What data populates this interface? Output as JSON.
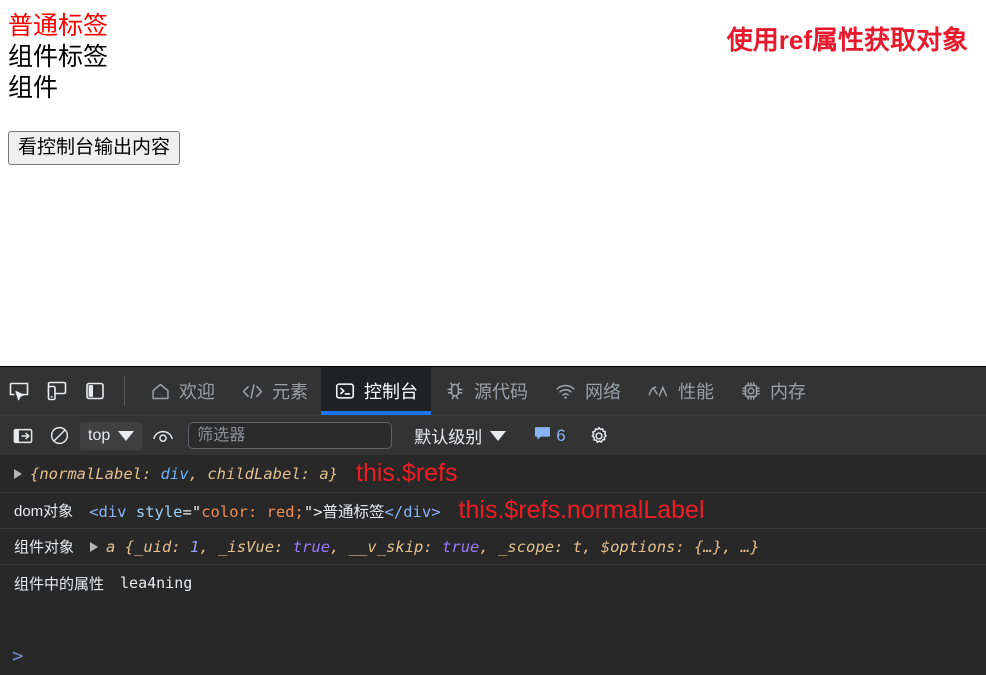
{
  "page": {
    "lines": [
      {
        "text": "普通标签",
        "color": "#ff0000"
      },
      {
        "text": "组件标签",
        "color": "#000000"
      },
      {
        "text": "组件",
        "color": "#000000"
      }
    ],
    "heading_right": "使用ref属性获取对象",
    "button_label": "看控制台输出内容"
  },
  "devtools": {
    "left_icons": [
      {
        "name": "inspect-element-icon",
        "title": "检查"
      },
      {
        "name": "device-toolbar-icon",
        "title": "设备工具栏"
      },
      {
        "name": "dock-panel-icon",
        "title": "停靠位置"
      }
    ],
    "tabs": [
      {
        "label": "欢迎",
        "icon": "home-icon",
        "active": false
      },
      {
        "label": "元素",
        "icon": "code-brackets-icon",
        "active": false
      },
      {
        "label": "控制台",
        "icon": "console-terminal-icon",
        "active": true
      },
      {
        "label": "源代码",
        "icon": "bug-icon",
        "active": false
      },
      {
        "label": "网络",
        "icon": "wifi-icon",
        "active": false
      },
      {
        "label": "性能",
        "icon": "gauge-icon",
        "active": false
      },
      {
        "label": "内存",
        "icon": "chip-icon",
        "active": false
      }
    ],
    "toolbar": {
      "sidebar_toggle": "console-sidebar-icon",
      "clear_console": "clear-console-icon",
      "context": "top",
      "eye_icon": "live-expression-icon",
      "filter_placeholder": "筛选器",
      "filter_value": "",
      "level": "默认级别",
      "issues_count": "6",
      "settings": "settings-gear-icon"
    },
    "accent_color": "#1a73e8",
    "annotation_color": "#ee1d25"
  },
  "console": {
    "rows": [
      {
        "id": "refs-object",
        "expandable": true,
        "label": "",
        "object_open": "{",
        "tokens": [
          {
            "t": "normalLabel",
            "c": "key"
          },
          {
            "t": ": ",
            "c": "punct"
          },
          {
            "t": "div",
            "c": "blue"
          },
          {
            "t": ", ",
            "c": "punct"
          },
          {
            "t": "childLabel",
            "c": "key"
          },
          {
            "t": ": ",
            "c": "punct"
          },
          {
            "t": "a",
            "c": "plain"
          }
        ],
        "object_close": "}",
        "annotation": "this.$refs"
      },
      {
        "id": "dom-object",
        "expandable": false,
        "label": "dom对象",
        "html_parts": {
          "open_tag": "<div ",
          "attr_name": "style",
          "eq_quote": "=\"",
          "attr_value": "color: red;",
          "quote_close": "\">",
          "inner_text": "普通标签",
          "close_tag": "</div>"
        },
        "annotation": "this.$refs.normalLabel"
      },
      {
        "id": "component-object",
        "expandable": true,
        "label": "组件对象",
        "ctor": "a ",
        "object_open": "{",
        "tokens": [
          {
            "t": "_uid",
            "c": "key"
          },
          {
            "t": ": ",
            "c": "punct"
          },
          {
            "t": "1",
            "c": "num"
          },
          {
            "t": ", ",
            "c": "punct"
          },
          {
            "t": "_isVue",
            "c": "key"
          },
          {
            "t": ": ",
            "c": "punct"
          },
          {
            "t": "true",
            "c": "bool"
          },
          {
            "t": ", ",
            "c": "punct"
          },
          {
            "t": "__v_skip",
            "c": "key"
          },
          {
            "t": ": ",
            "c": "punct"
          },
          {
            "t": "true",
            "c": "bool"
          },
          {
            "t": ", ",
            "c": "punct"
          },
          {
            "t": "_scope",
            "c": "key"
          },
          {
            "t": ": ",
            "c": "punct"
          },
          {
            "t": "t",
            "c": "plain"
          },
          {
            "t": ", ",
            "c": "punct"
          },
          {
            "t": "$options",
            "c": "key"
          },
          {
            "t": ": ",
            "c": "punct"
          },
          {
            "t": "{…}",
            "c": "plain"
          },
          {
            "t": ", …",
            "c": "punct"
          }
        ],
        "object_close": "}",
        "annotation": ""
      },
      {
        "id": "component-property",
        "expandable": false,
        "label": "组件中的属性",
        "value": "lea4ning",
        "annotation": ""
      }
    ],
    "prompt_caret": ">"
  }
}
